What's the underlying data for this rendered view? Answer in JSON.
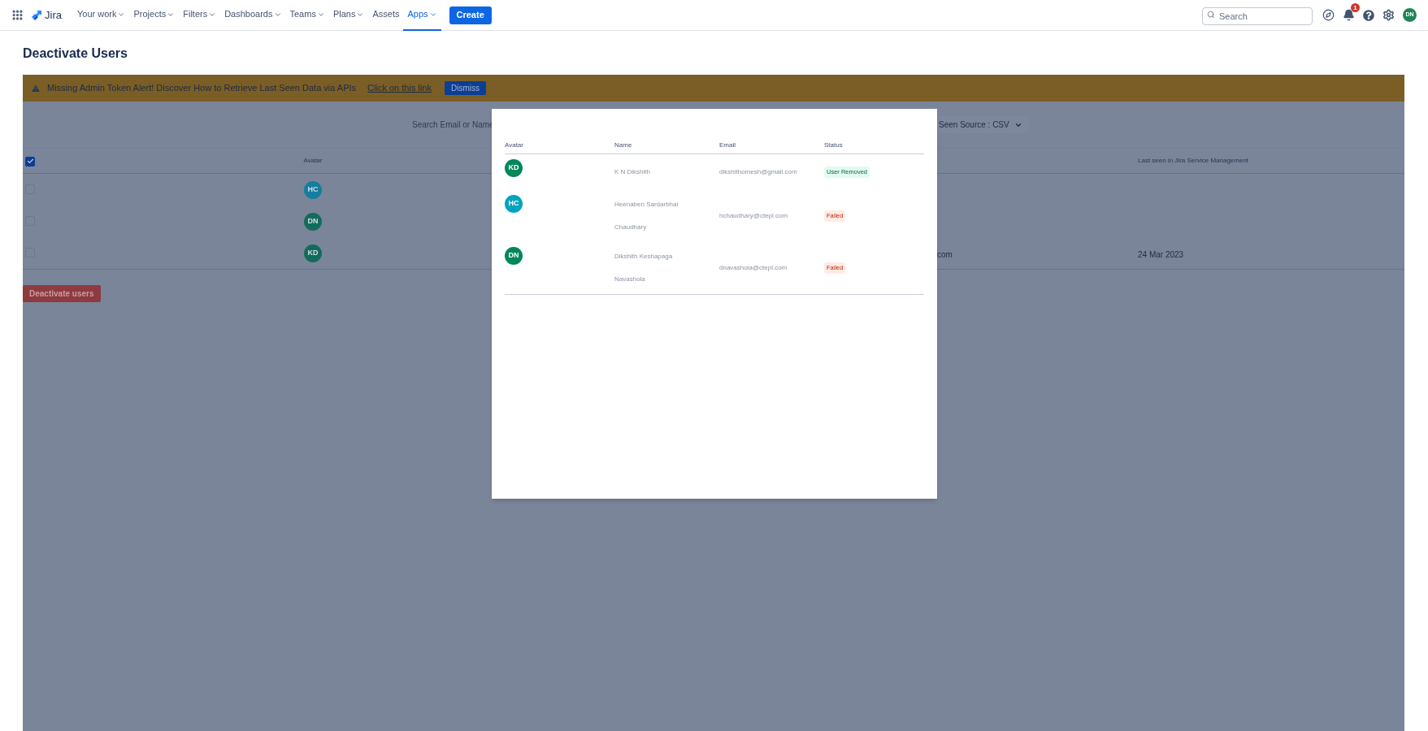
{
  "nav": {
    "app_name": "Jira",
    "items": [
      {
        "label": "Your work",
        "dropdown": true,
        "selected": false
      },
      {
        "label": "Projects",
        "dropdown": true,
        "selected": false
      },
      {
        "label": "Filters",
        "dropdown": true,
        "selected": false
      },
      {
        "label": "Dashboards",
        "dropdown": true,
        "selected": false
      },
      {
        "label": "Teams",
        "dropdown": true,
        "selected": false
      },
      {
        "label": "Plans",
        "dropdown": true,
        "selected": false
      },
      {
        "label": "Assets",
        "dropdown": false,
        "selected": false
      },
      {
        "label": "Apps",
        "dropdown": true,
        "selected": true
      }
    ],
    "create": "Create",
    "search_placeholder": "Search",
    "notification_count": "1",
    "avatar": "DN"
  },
  "page": {
    "title": "Deactivate Users"
  },
  "alert": {
    "text": "Missing Admin Token Alert! Discover How to Retrieve Last Seen Data via APIs",
    "link": "Click on this link",
    "dismiss": "Dismiss"
  },
  "filter": {
    "search_label": "Search Email or Name",
    "source_dropdown": "Seen Source : CSV"
  },
  "table": {
    "select_all_checked": true,
    "avatar_header": "Avatar",
    "last_seen_header": "Last seen in Jira Service Management",
    "rows": [
      {
        "checked": false,
        "avatar": "HC",
        "color": "#137e9e"
      },
      {
        "checked": false,
        "avatar": "DN",
        "color": "#126b5c"
      },
      {
        "checked": false,
        "avatar": "KD",
        "color": "#126b5c",
        "email_fragment": "com",
        "last_seen": "24 Mar 2023"
      }
    ]
  },
  "deactivate_button": "Deactivate users",
  "modal": {
    "columns": [
      "Avatar",
      "Name",
      "Email",
      "Status"
    ],
    "rows": [
      {
        "avatar": "KD",
        "color": "#00875a",
        "name": "K N Dikshith",
        "email": "dikshithomesh@gmail.com",
        "status": "User Removed",
        "kind": "success"
      },
      {
        "avatar": "HC",
        "color": "#00a3bf",
        "name": "Heenaben Sardarbhai Chaudhary",
        "email": "hchaudhary@ctepl.com",
        "status": "Failed",
        "kind": "failed"
      },
      {
        "avatar": "DN",
        "color": "#00875a",
        "name": "Dikshith Keshapaga Navashola",
        "email": "dnavashola@ctepl.com",
        "status": "Failed",
        "kind": "failed"
      }
    ]
  }
}
